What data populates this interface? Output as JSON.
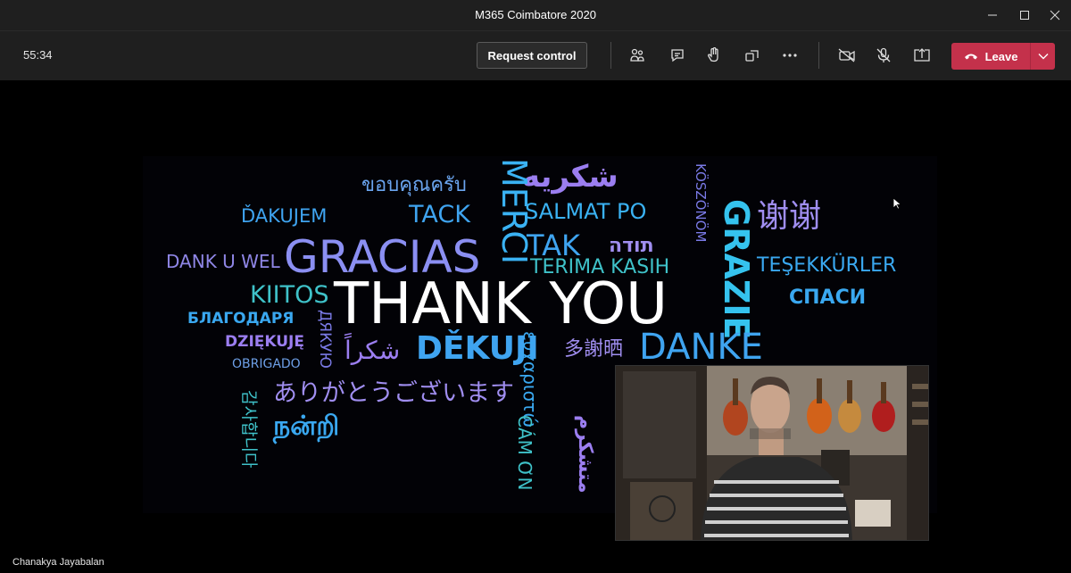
{
  "window": {
    "title": "M365 Coimbatore 2020",
    "controls": {
      "minimize": "minimize-icon",
      "maximize": "maximize-icon",
      "close": "close-icon"
    }
  },
  "toolbar": {
    "timer": "55:34",
    "request_control_label": "Request control",
    "buttons": [
      "people-icon",
      "chat-icon",
      "raise-hand-icon",
      "rooms-icon",
      "more-icon",
      "camera-off-icon",
      "mic-off-icon",
      "share-icon"
    ],
    "leave_label": "Leave",
    "leave_color": "#c4314b"
  },
  "slide": {
    "words": [
      "ขอบคุณครับ",
      "شكريه",
      "MERCI",
      "KÖSZÖNÖM",
      "ĎAKUJEM",
      "TACK",
      "SALMAT PO",
      "GRAZIE",
      "谢谢",
      "DANK U WEL",
      "GRACIAS",
      "TAK",
      "תודה",
      "TERIMA KASIH",
      "TEŞEKKÜRLER",
      "KIITOS",
      "THANK YOU",
      "СПАСИ",
      "БЛАГОДАРЯ",
      "ДЯКУЮ",
      "DZIĘKUJĘ",
      "OBRIGADO",
      "شكراً",
      "DĚKUJI",
      "ευχαριστώ",
      "多謝晒",
      "DANKE",
      "감사합니다",
      "ありがとうございます",
      "நன்றி",
      "CÁM ƠN",
      "متشکرم"
    ]
  },
  "presenter": {
    "name": "Chanakya Jayabalan"
  }
}
